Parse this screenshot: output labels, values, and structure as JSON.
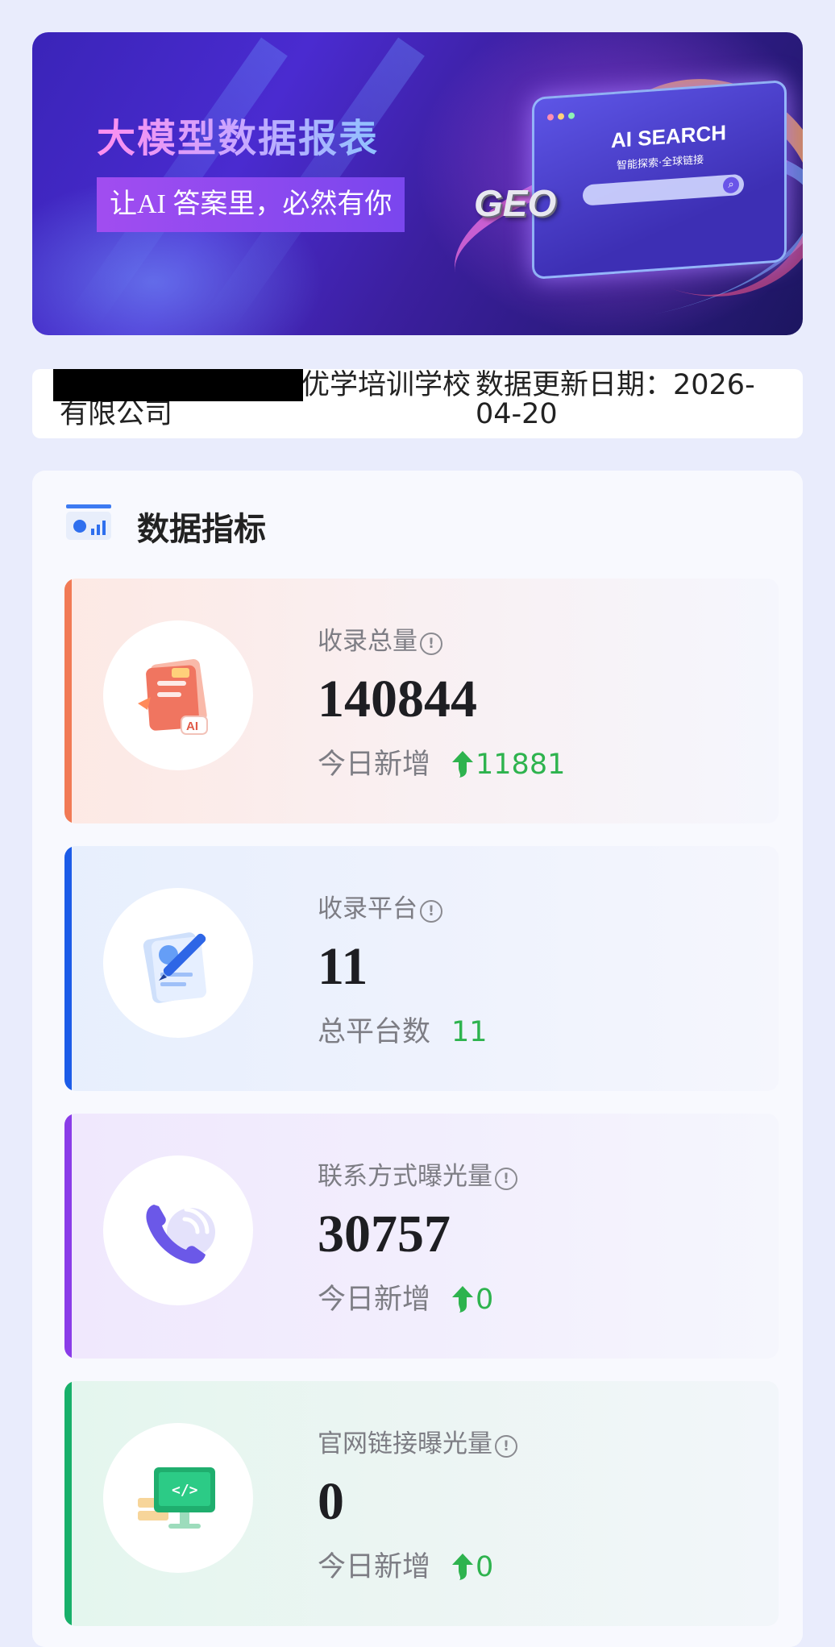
{
  "banner": {
    "title": "大模型数据报表",
    "slogan": "让AI 答案里，必然有你",
    "art_title": "AI SEARCH",
    "art_subtitle": "智能探索·全球链接",
    "art_badge": "GEO"
  },
  "info": {
    "company_name": "优学培训学校有限公司",
    "update_date_text": "数据更新日期：2026-04-20"
  },
  "metrics_panel": {
    "title": "数据指标",
    "info_icon_glyph": "!",
    "cards": [
      {
        "label": "收录总量",
        "value": "140844",
        "sub_label": "今日新增",
        "sub_value": "11881",
        "show_up_arrow": true,
        "accent_color": "#f17a55",
        "icon": "document-ai-icon"
      },
      {
        "label": "收录平台",
        "value": "11",
        "sub_label": "总平台数",
        "sub_value": "11",
        "show_up_arrow": false,
        "accent_color": "#1c5ce8",
        "icon": "notepad-pen-icon"
      },
      {
        "label": "联系方式曝光量",
        "value": "30757",
        "sub_label": "今日新增",
        "sub_value": "0",
        "show_up_arrow": true,
        "accent_color": "#8a3ce8",
        "icon": "phone-icon"
      },
      {
        "label": "官网链接曝光量",
        "value": "0",
        "sub_label": "今日新增",
        "sub_value": "0",
        "show_up_arrow": true,
        "accent_color": "#18b06a",
        "icon": "computer-code-icon"
      }
    ]
  },
  "colors": {
    "page_bg": "#e9ecfc",
    "positive_green": "#2eb34e",
    "value_text": "#1e1e22",
    "muted_text": "#7d7d84"
  }
}
